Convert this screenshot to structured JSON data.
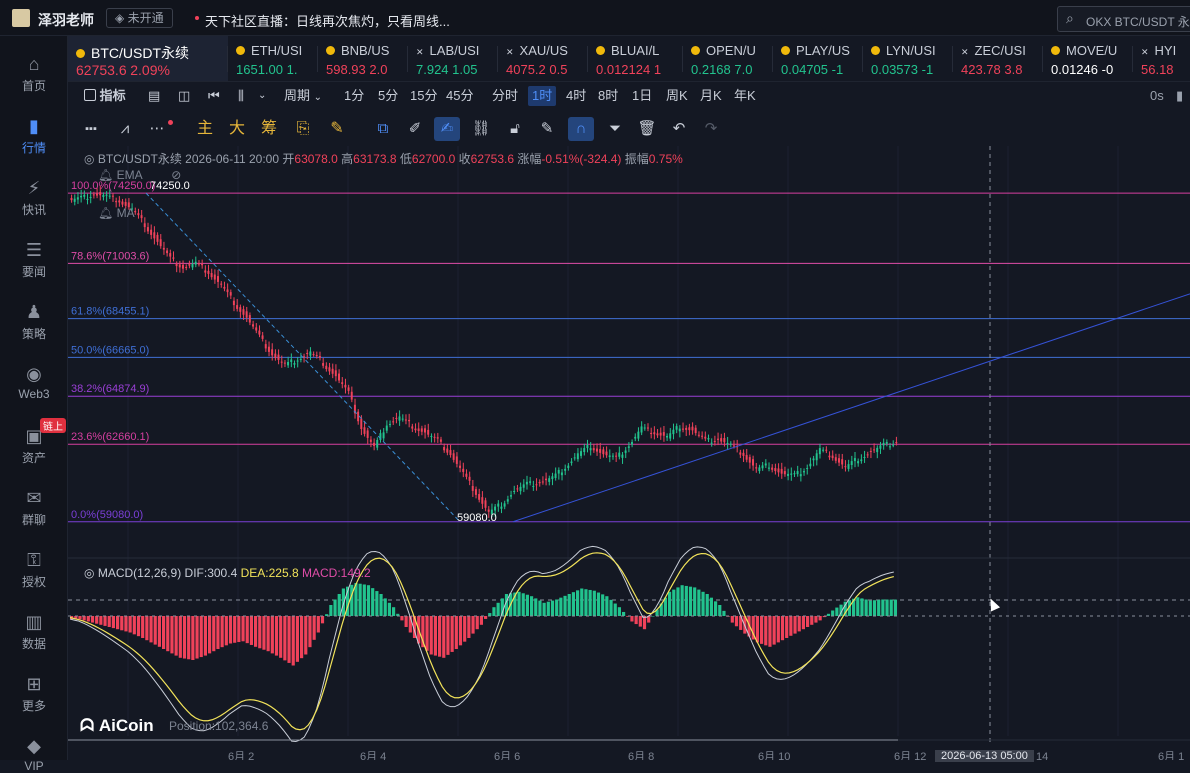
{
  "app": {
    "teacher_name": "泽羽老师",
    "vip_status": "未开通",
    "live_text": "天下社区直播：日线再次焦灼，只看周线...",
    "search_placeholder": "OKX BTC/USDT 永"
  },
  "sidebar": {
    "items": [
      {
        "label": "首页",
        "icon": "home-icon"
      },
      {
        "label": "行情",
        "icon": "market-icon",
        "active": true
      },
      {
        "label": "快讯",
        "icon": "news-flash-icon"
      },
      {
        "label": "要闻",
        "icon": "headline-icon"
      },
      {
        "label": "策略",
        "icon": "strategy-icon"
      },
      {
        "label": "Web3",
        "icon": "web3-icon"
      },
      {
        "label": "资产",
        "icon": "wallet-icon",
        "badge": "链上"
      },
      {
        "label": "群聊",
        "icon": "chat-icon"
      },
      {
        "label": "授权",
        "icon": "key-icon"
      },
      {
        "label": "数据",
        "icon": "data-icon"
      },
      {
        "label": "更多",
        "icon": "more-grid-icon"
      },
      {
        "label": "VIP",
        "icon": "vip-diamond-icon"
      }
    ]
  },
  "tickers": [
    {
      "name": "BTC/USDT永续",
      "price": "62753.6",
      "change": "2.09%",
      "color": "#f0425a",
      "active": true
    },
    {
      "name": "ETH/USI",
      "price": "1651.00",
      "change": "1.",
      "color": "#22c38e"
    },
    {
      "name": "BNB/US",
      "price": "598.93",
      "change": "2.0",
      "color": "#f0425a"
    },
    {
      "name": "LAB/USI",
      "price": "7.924",
      "change": "1.05",
      "color": "#22c38e"
    },
    {
      "name": "XAU/US",
      "price": "4075.2",
      "change": "0.5",
      "color": "#f0425a"
    },
    {
      "name": "BLUAI/L",
      "price": "0.012124",
      "change": "1",
      "color": "#f0425a"
    },
    {
      "name": "OPEN/U",
      "price": "0.2168",
      "change": "7.0",
      "color": "#22c38e"
    },
    {
      "name": "PLAY/US",
      "price": "0.04705",
      "change": "-1",
      "color": "#22c38e"
    },
    {
      "name": "LYN/USI",
      "price": "0.03573",
      "change": "-1",
      "color": "#22c38e"
    },
    {
      "name": "ZEC/USI",
      "price": "423.78",
      "change": "3.8",
      "color": "#f0425a"
    },
    {
      "name": "MOVE/U",
      "price": "0.01246",
      "change": "-0",
      "color": "#ffffff"
    },
    {
      "name": "HYI",
      "price": "56.18",
      "change": "",
      "color": "#f0425a"
    }
  ],
  "periodbar": {
    "indicator_label": "指标",
    "period_dropdown": "周期",
    "periods": [
      "1分",
      "5分",
      "15分",
      "45分",
      "分时",
      "1时",
      "4时",
      "8时",
      "1日",
      "周K",
      "月K",
      "年K"
    ],
    "selected_period": "1时",
    "timer": "0s"
  },
  "toolbar": {
    "main_label": "主",
    "sub_label": "大",
    "chip_label": "筹"
  },
  "chart_info": {
    "symbol": "BTC/USDT永续",
    "datetime": "2026-06-11 20:00",
    "open_label": "开",
    "open": "63078.0",
    "high_label": "高",
    "high": "63173.8",
    "low_label": "低",
    "low": "62700.0",
    "close_label": "收",
    "close": "62753.6",
    "chg_label": "涨幅",
    "chg": "-0.51%(-324.4)",
    "amp_label": "振幅",
    "amp": "0.75%",
    "ema_label": "EMA",
    "ma_label": "MA",
    "macd_label": "MACD(12,26,9)",
    "dif": "DIF:300.4",
    "dea": "DEA:225.8",
    "macd": "MACD:149.2",
    "position": "Position:102,364.6",
    "brand": "AiCoin",
    "crosshair_time": "2026-06-13 05:00"
  },
  "chart_data": {
    "type": "candlestick",
    "ylim": [
      57500,
      75500
    ],
    "fib_levels": [
      {
        "label": "100.0%(74250.0)",
        "value": 74250.0,
        "color": "#d63fa0"
      },
      {
        "label": "78.6%(71003.6)",
        "value": 71003.6,
        "color": "#e04da8"
      },
      {
        "label": "61.8%(68455.1)",
        "value": 68455.1,
        "color": "#3f6fd6"
      },
      {
        "label": "50.0%(66665.0)",
        "value": 66665.0,
        "color": "#3f6fd6"
      },
      {
        "label": "38.2%(64874.9)",
        "value": 64874.9,
        "color": "#9a3fd6"
      },
      {
        "label": "23.6%(62660.1)",
        "value": 62660.1,
        "color": "#d63fa0"
      },
      {
        "label": "0.0%(59080.0)",
        "value": 59080.0,
        "color": "#7a3fd6"
      }
    ],
    "high_marker": "74250.0",
    "low_marker": "59080.0",
    "x_ticks": [
      "6月 2",
      "6月 4",
      "6月 6",
      "6月 8",
      "6月 10",
      "6月 12",
      "14",
      "6月 1"
    ],
    "close_path": [
      73900,
      74000,
      74200,
      74100,
      73900,
      73500,
      72800,
      72000,
      71200,
      70800,
      71000,
      70600,
      70000,
      69200,
      68500,
      67600,
      66800,
      66300,
      66600,
      66900,
      66400,
      65800,
      65000,
      63400,
      62500,
      63600,
      63900,
      63500,
      63200,
      62800,
      62200,
      61300,
      60400,
      59500,
      59900,
      60500,
      60800,
      60900,
      61100,
      61600,
      62200,
      62600,
      62200,
      62000,
      62600,
      63400,
      63200,
      63000,
      63500,
      63300,
      62800,
      62900,
      62600,
      62200,
      61500,
      61700,
      61300,
      61200,
      61600,
      62400,
      62100,
      61600,
      62000,
      62300,
      62600,
      62760
    ],
    "macd_hist": [
      -30,
      -60,
      -90,
      -120,
      -150,
      -200,
      -260,
      -320,
      -380,
      -400,
      -360,
      -300,
      -250,
      -230,
      -280,
      -320,
      -380,
      -450,
      -350,
      -150,
      100,
      250,
      300,
      280,
      200,
      80,
      -100,
      -250,
      -350,
      -380,
      -300,
      -200,
      -80,
      80,
      200,
      220,
      180,
      120,
      150,
      200,
      250,
      230,
      180,
      80,
      -50,
      -120,
      60,
      220,
      280,
      260,
      200,
      100,
      -60,
      -160,
      -240,
      -280,
      -220,
      -160,
      -100,
      -40,
      50,
      130,
      170,
      140,
      150,
      149
    ]
  }
}
